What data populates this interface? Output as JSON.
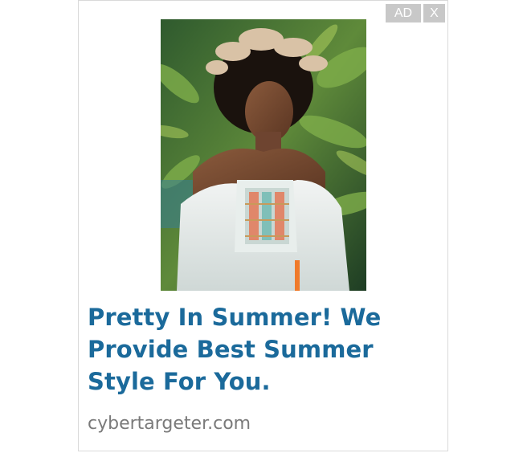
{
  "ad": {
    "badge_label": "AD",
    "close_label": "X",
    "headline": "Pretty In Summer! We Provide Best Summer Style For You.",
    "domain": "cybertargeter.com",
    "colors": {
      "headline": "#1b6a9b",
      "domain": "#7a7a7a",
      "badge_bg": "#c8c8c8"
    },
    "image": {
      "icon": "woman-summer-dress-photo"
    }
  }
}
